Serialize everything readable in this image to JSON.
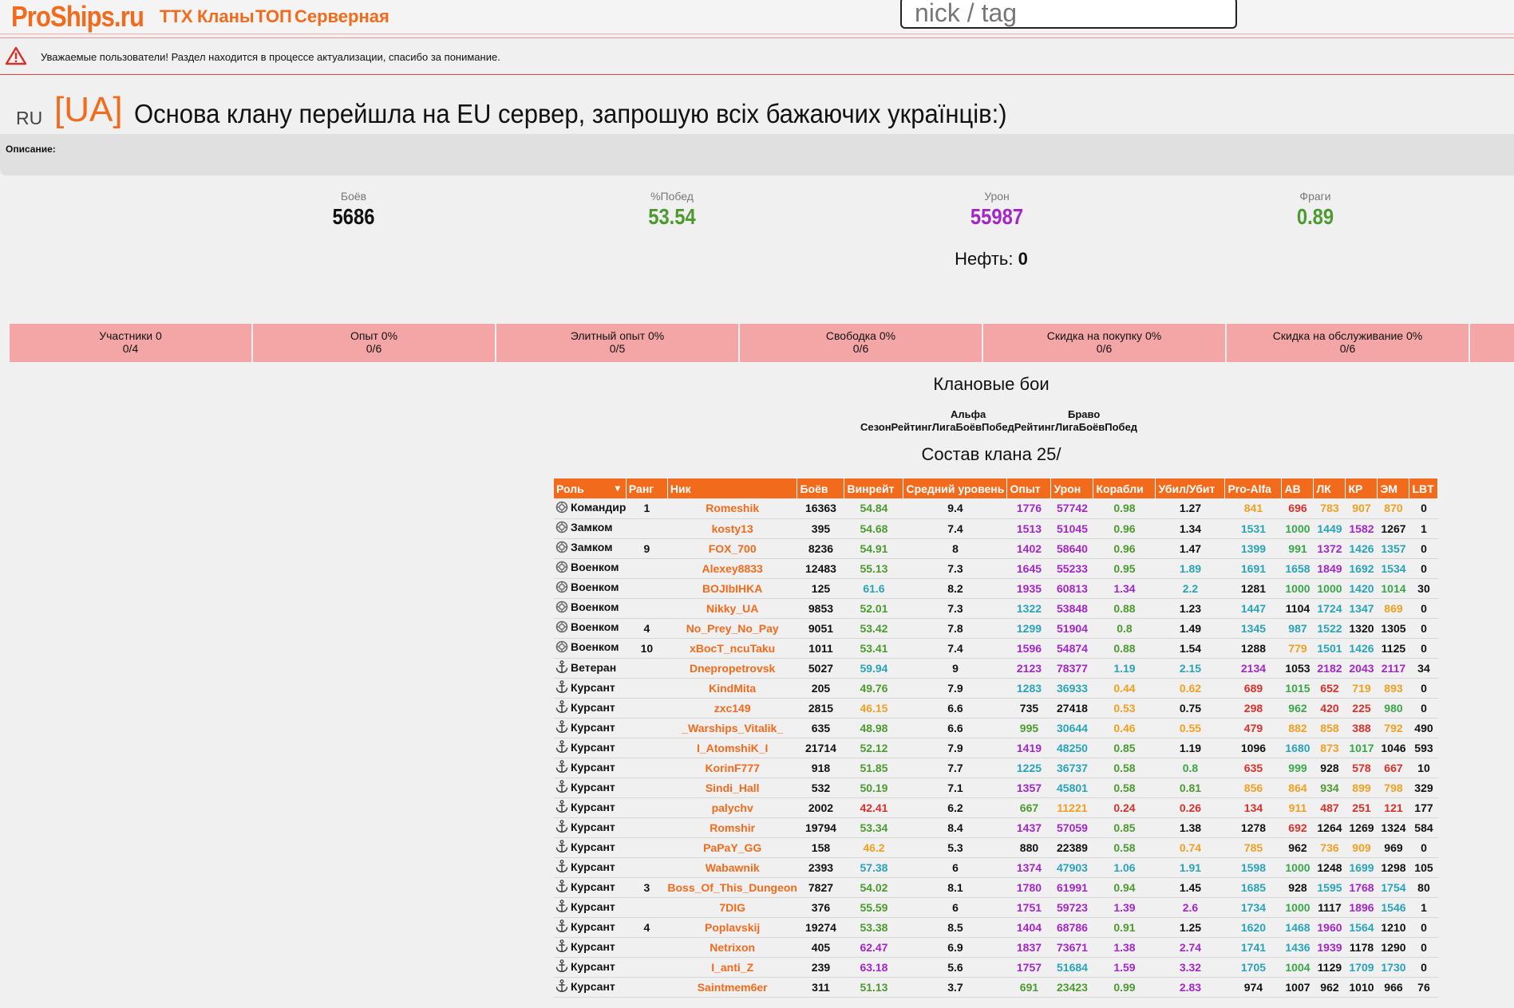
{
  "header": {
    "logo": "ProShips.ru",
    "nav": [
      {
        "label": "ТТХ",
        "left": 0
      },
      {
        "label": "Кланы",
        "left": 0
      },
      {
        "label": "ТОП",
        "left": 0
      },
      {
        "label": "Серверная",
        "left": 0
      }
    ],
    "search_placeholder": "nick / tag"
  },
  "notice": {
    "text": "Уважаемые пользователи! Раздел находится в процессе актуализации, спасибо за понимание."
  },
  "clan": {
    "server": "RU",
    "tag": "[UA]",
    "title": "Основа клану перейшла на EU сервер, запрошую всіх бажаючих українців:)",
    "description_label": "Описание:"
  },
  "stats": [
    {
      "label": "Боёв",
      "value": "5686",
      "color": "#111111"
    },
    {
      "label": "%Побед",
      "value": "53.54",
      "color": "#4c9a30"
    },
    {
      "label": "Урон",
      "value": "55987",
      "color": "#a326c6"
    },
    {
      "label": "Фраги",
      "value": "0.89",
      "color": "#4c9a30"
    }
  ],
  "oil": {
    "label": "Нефть:",
    "value": "0"
  },
  "bonuses": [
    {
      "label": "Участники 0",
      "value": "0/4"
    },
    {
      "label": "Опыт 0%",
      "value": "0/6"
    },
    {
      "label": "Элитный опыт 0%",
      "value": "0/5"
    },
    {
      "label": "Свободка 0%",
      "value": "0/6"
    },
    {
      "label": "Скидка на покупку 0%",
      "value": "0/6"
    },
    {
      "label": "Скидка на обслуживание 0%",
      "value": "0/6"
    }
  ],
  "clan_battles": {
    "title": "Клановые бои",
    "alpha": "Альфа",
    "bravo": "Браво",
    "header_row": "СезонРейтингЛигаБоёвПобедРейтингЛигаБоёвПобед"
  },
  "roster": {
    "title": "Состав клана 25/",
    "columns": [
      "Роль",
      "Ранг",
      "Ник",
      "Боёв",
      "Винрейт",
      "Средний уровень",
      "Опыт",
      "Урон",
      "Корабли",
      "Убил/Убит",
      "Pro-Alfa",
      "АВ",
      "ЛК",
      "КР",
      "ЭМ",
      "LBT"
    ],
    "rows": [
      [
        "Командир",
        "1",
        "Romeshik",
        "16363",
        "54.84",
        "9.4",
        "1776",
        "57742",
        "0.98",
        "1.27",
        "841",
        "696",
        "783",
        "907",
        "870",
        "0"
      ],
      [
        "Замком",
        "",
        "kosty13",
        "395",
        "54.68",
        "7.4",
        "1513",
        "51045",
        "0.96",
        "1.34",
        "1531",
        "1000",
        "1449",
        "1582",
        "1267",
        "1"
      ],
      [
        "Замком",
        "9",
        "FOX_700",
        "8236",
        "54.91",
        "8",
        "1402",
        "58640",
        "0.96",
        "1.47",
        "1399",
        "991",
        "1372",
        "1426",
        "1357",
        "0"
      ],
      [
        "Военком",
        "",
        "Alexey8833",
        "12483",
        "55.13",
        "7.3",
        "1645",
        "55233",
        "0.95",
        "1.89",
        "1691",
        "1658",
        "1849",
        "1692",
        "1534",
        "0"
      ],
      [
        "Военком",
        "",
        "BOJIbIHKA",
        "125",
        "61.6",
        "8.2",
        "1935",
        "60813",
        "1.34",
        "2.2",
        "1281",
        "1000",
        "1000",
        "1420",
        "1014",
        "30"
      ],
      [
        "Военком",
        "",
        "Nikky_UA",
        "9853",
        "52.01",
        "7.3",
        "1322",
        "53848",
        "0.88",
        "1.23",
        "1447",
        "1104",
        "1724",
        "1347",
        "869",
        "0"
      ],
      [
        "Военком",
        "4",
        "No_Prey_No_Pay",
        "9051",
        "53.42",
        "7.8",
        "1299",
        "51904",
        "0.8",
        "1.49",
        "1345",
        "987",
        "1522",
        "1320",
        "1305",
        "0"
      ],
      [
        "Военком",
        "10",
        "xBocT_ncuTaku",
        "1011",
        "53.41",
        "7.4",
        "1596",
        "54874",
        "0.88",
        "1.54",
        "1288",
        "779",
        "1501",
        "1426",
        "1125",
        "0"
      ],
      [
        "Ветеран",
        "",
        "Dnepropetrovsk",
        "5027",
        "59.94",
        "9",
        "2123",
        "78377",
        "1.19",
        "2.15",
        "2134",
        "1053",
        "2182",
        "2043",
        "2117",
        "34"
      ],
      [
        "Курсант",
        "",
        "KindMita",
        "205",
        "49.76",
        "7.9",
        "1283",
        "36933",
        "0.44",
        "0.62",
        "689",
        "1015",
        "652",
        "719",
        "893",
        "0"
      ],
      [
        "Курсант",
        "",
        "zxc149",
        "2815",
        "46.15",
        "6.6",
        "735",
        "27418",
        "0.53",
        "0.75",
        "298",
        "962",
        "420",
        "225",
        "980",
        "0"
      ],
      [
        "Курсант",
        "",
        "_Warships_Vitalik_",
        "635",
        "48.98",
        "6.6",
        "995",
        "30644",
        "0.46",
        "0.55",
        "479",
        "882",
        "858",
        "388",
        "792",
        "490"
      ],
      [
        "Курсант",
        "",
        "I_AtomshiK_I",
        "21714",
        "52.12",
        "7.9",
        "1419",
        "48250",
        "0.85",
        "1.19",
        "1096",
        "1680",
        "873",
        "1017",
        "1046",
        "593"
      ],
      [
        "Курсант",
        "",
        "KorinF777",
        "918",
        "51.85",
        "7.7",
        "1225",
        "36737",
        "0.58",
        "0.8",
        "635",
        "999",
        "928",
        "578",
        "667",
        "10"
      ],
      [
        "Курсант",
        "",
        "Sindi_Hall",
        "532",
        "50.19",
        "7.1",
        "1357",
        "45801",
        "0.58",
        "0.81",
        "856",
        "864",
        "934",
        "899",
        "798",
        "329"
      ],
      [
        "Курсант",
        "",
        "palychv",
        "2002",
        "42.41",
        "6.2",
        "667",
        "11221",
        "0.24",
        "0.26",
        "134",
        "911",
        "487",
        "251",
        "121",
        "177"
      ],
      [
        "Курсант",
        "",
        "Romshir",
        "19794",
        "53.34",
        "8.4",
        "1437",
        "57059",
        "0.85",
        "1.38",
        "1278",
        "692",
        "1264",
        "1269",
        "1324",
        "584"
      ],
      [
        "Курсант",
        "",
        "PaPaY_GG",
        "158",
        "46.2",
        "5.3",
        "880",
        "22389",
        "0.58",
        "0.74",
        "785",
        "962",
        "736",
        "909",
        "969",
        "0"
      ],
      [
        "Курсант",
        "",
        "Wabawnik",
        "2393",
        "57.38",
        "6",
        "1374",
        "47903",
        "1.06",
        "1.91",
        "1598",
        "1000",
        "1248",
        "1699",
        "1298",
        "105"
      ],
      [
        "Курсант",
        "3",
        "Boss_Of_This_Dungeon",
        "7827",
        "54.02",
        "8.1",
        "1780",
        "61991",
        "0.94",
        "1.45",
        "1685",
        "928",
        "1595",
        "1768",
        "1754",
        "80"
      ],
      [
        "Курсант",
        "",
        "7DIG",
        "376",
        "55.59",
        "6",
        "1751",
        "59723",
        "1.39",
        "2.6",
        "1734",
        "1000",
        "1117",
        "1896",
        "1546",
        "1"
      ],
      [
        "Курсант",
        "4",
        "Poplavskij",
        "19274",
        "53.38",
        "8.5",
        "1404",
        "68786",
        "0.91",
        "1.25",
        "1620",
        "1468",
        "1960",
        "1564",
        "1210",
        "0"
      ],
      [
        "Курсант",
        "",
        "Netrixon",
        "405",
        "62.47",
        "6.9",
        "1837",
        "73671",
        "1.38",
        "2.74",
        "1741",
        "1436",
        "1939",
        "1178",
        "1290",
        "0"
      ],
      [
        "Курсант",
        "",
        "I_anti_Z",
        "239",
        "63.18",
        "5.6",
        "1757",
        "51684",
        "1.59",
        "3.32",
        "1705",
        "1004",
        "1129",
        "1709",
        "1730",
        "0"
      ],
      [
        "Курсант",
        "",
        "Saintmem6er",
        "311",
        "51.13",
        "3.7",
        "691",
        "23423",
        "0.99",
        "2.83",
        "974",
        "1007",
        "962",
        "1010",
        "966",
        "76"
      ]
    ],
    "cell_colors": [
      [
        "black",
        "black",
        "orange",
        "black",
        "green",
        "black",
        "purple",
        "purple",
        "green",
        "black",
        "orange",
        "red",
        "orange",
        "orange",
        "orange",
        "black"
      ],
      [
        "black",
        "black",
        "orange",
        "black",
        "green",
        "black",
        "purple",
        "purple",
        "green",
        "black",
        "teal",
        "lgreen",
        "teal",
        "purple",
        "black",
        "black"
      ],
      [
        "black",
        "black",
        "orange",
        "black",
        "green",
        "black",
        "purple",
        "purple",
        "green",
        "black",
        "teal",
        "lgreen",
        "purple",
        "teal",
        "teal",
        "black"
      ],
      [
        "black",
        "black",
        "orange",
        "black",
        "green",
        "black",
        "purple",
        "purple",
        "green",
        "teal",
        "teal",
        "teal",
        "purple",
        "teal",
        "teal",
        "black"
      ],
      [
        "black",
        "black",
        "orange",
        "black",
        "teal",
        "black",
        "purple",
        "purple",
        "purple",
        "teal",
        "black",
        "lgreen",
        "lgreen",
        "teal",
        "lgreen",
        "black"
      ],
      [
        "black",
        "black",
        "orange",
        "black",
        "green",
        "black",
        "teal",
        "purple",
        "green",
        "black",
        "teal",
        "black",
        "teal",
        "teal",
        "orange",
        "black"
      ],
      [
        "black",
        "black",
        "orange",
        "black",
        "green",
        "black",
        "teal",
        "purple",
        "green",
        "black",
        "teal",
        "teal",
        "teal",
        "black",
        "black",
        "black"
      ],
      [
        "black",
        "black",
        "orange",
        "black",
        "green",
        "black",
        "purple",
        "purple",
        "green",
        "black",
        "black",
        "orange",
        "teal",
        "teal",
        "black",
        "black"
      ],
      [
        "black",
        "black",
        "orange",
        "black",
        "teal",
        "black",
        "purple",
        "purple",
        "teal",
        "teal",
        "purple",
        "black",
        "purple",
        "purple",
        "purple",
        "black"
      ],
      [
        "black",
        "black",
        "orange",
        "black",
        "green",
        "black",
        "teal",
        "teal",
        "orange",
        "orange",
        "red",
        "lgreen",
        "red",
        "orange",
        "orange",
        "black"
      ],
      [
        "black",
        "black",
        "orange",
        "black",
        "orange",
        "black",
        "black",
        "black",
        "orange",
        "black",
        "red",
        "lgreen",
        "red",
        "red",
        "lgreen",
        "black"
      ],
      [
        "black",
        "black",
        "orange",
        "black",
        "green",
        "black",
        "green",
        "teal",
        "orange",
        "orange",
        "red",
        "orange",
        "orange",
        "red",
        "orange",
        "black"
      ],
      [
        "black",
        "black",
        "orange",
        "black",
        "green",
        "black",
        "purple",
        "teal",
        "green",
        "black",
        "black",
        "teal",
        "orange",
        "lgreen",
        "black",
        "black"
      ],
      [
        "black",
        "black",
        "orange",
        "black",
        "green",
        "black",
        "teal",
        "teal",
        "green",
        "lgreen",
        "red",
        "lgreen",
        "black",
        "red",
        "red",
        "black"
      ],
      [
        "black",
        "black",
        "orange",
        "black",
        "green",
        "black",
        "purple",
        "teal",
        "green",
        "green",
        "orange",
        "orange",
        "green",
        "orange",
        "orange",
        "black"
      ],
      [
        "black",
        "black",
        "orange",
        "black",
        "red",
        "black",
        "green",
        "orange",
        "red",
        "red",
        "red",
        "orange",
        "red",
        "red",
        "red",
        "black"
      ],
      [
        "black",
        "black",
        "orange",
        "black",
        "green",
        "black",
        "purple",
        "purple",
        "green",
        "black",
        "black",
        "red",
        "black",
        "black",
        "black",
        "black"
      ],
      [
        "black",
        "black",
        "orange",
        "black",
        "orange",
        "black",
        "black",
        "black",
        "green",
        "orange",
        "orange",
        "black",
        "orange",
        "orange",
        "black",
        "black"
      ],
      [
        "black",
        "black",
        "orange",
        "black",
        "teal",
        "black",
        "purple",
        "teal",
        "teal",
        "teal",
        "teal",
        "lgreen",
        "black",
        "teal",
        "black",
        "black"
      ],
      [
        "black",
        "black",
        "orange",
        "black",
        "green",
        "black",
        "purple",
        "purple",
        "green",
        "black",
        "teal",
        "black",
        "teal",
        "purple",
        "teal",
        "black"
      ],
      [
        "black",
        "black",
        "orange",
        "black",
        "green",
        "black",
        "purple",
        "purple",
        "purple",
        "purple",
        "teal",
        "lgreen",
        "black",
        "purple",
        "teal",
        "black"
      ],
      [
        "black",
        "black",
        "orange",
        "black",
        "green",
        "black",
        "purple",
        "purple",
        "green",
        "black",
        "teal",
        "teal",
        "purple",
        "teal",
        "black",
        "black"
      ],
      [
        "black",
        "black",
        "orange",
        "black",
        "purple",
        "black",
        "purple",
        "purple",
        "purple",
        "purple",
        "teal",
        "teal",
        "purple",
        "black",
        "black",
        "black"
      ],
      [
        "black",
        "black",
        "orange",
        "black",
        "purple",
        "black",
        "purple",
        "teal",
        "purple",
        "purple",
        "teal",
        "lgreen",
        "black",
        "teal",
        "teal",
        "black"
      ],
      [
        "black",
        "black",
        "orange",
        "black",
        "green",
        "black",
        "green",
        "green",
        "green",
        "purple",
        "black",
        "black",
        "black",
        "black",
        "black",
        "black"
      ]
    ]
  }
}
